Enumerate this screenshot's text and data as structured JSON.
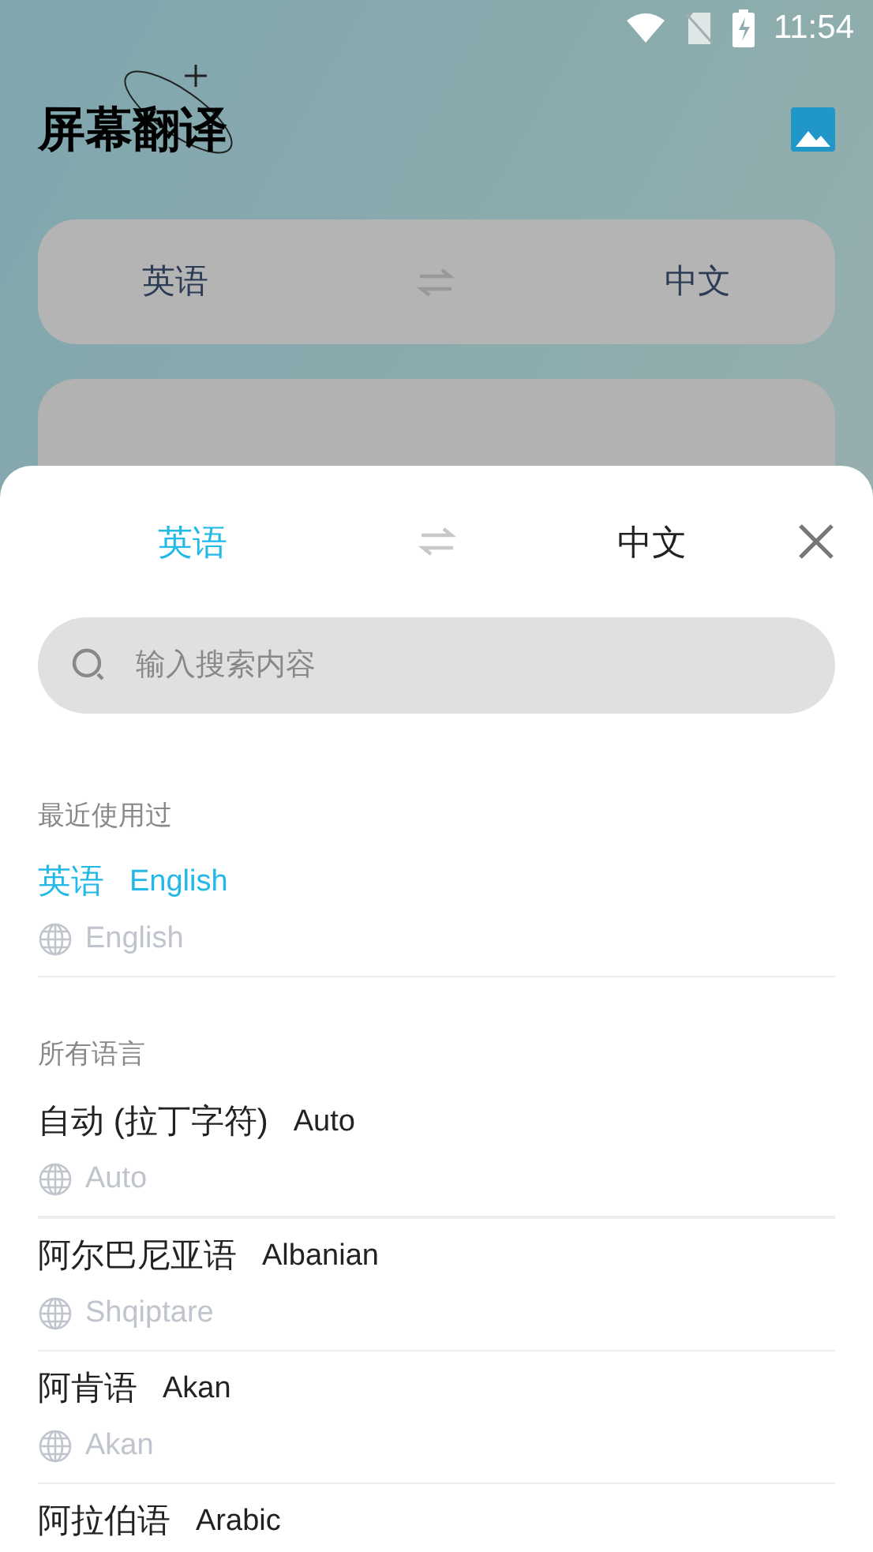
{
  "status_bar": {
    "time": "11:54"
  },
  "app": {
    "title": "屏幕翻译"
  },
  "background_languages": {
    "source": "英语",
    "target": "中文"
  },
  "sheet": {
    "tabs": [
      {
        "label": "英语",
        "selected": true
      },
      {
        "label": "中文",
        "selected": false
      }
    ],
    "search": {
      "placeholder": "输入搜索内容"
    },
    "sections": [
      {
        "title": "最近使用过",
        "items": [
          {
            "name": "英语",
            "english": "English",
            "native": "English",
            "selected": true
          }
        ]
      },
      {
        "title": "所有语言",
        "items": [
          {
            "name": "自动 (拉丁字符)",
            "english": "Auto",
            "native": "Auto",
            "selected": false
          },
          {
            "name": "阿尔巴尼亚语",
            "english": "Albanian",
            "native": "Shqiptare",
            "selected": false
          },
          {
            "name": "阿肯语",
            "english": "Akan",
            "native": "Akan",
            "selected": false
          },
          {
            "name": "阿拉伯语",
            "english": "Arabic",
            "selected": false
          }
        ]
      }
    ]
  }
}
